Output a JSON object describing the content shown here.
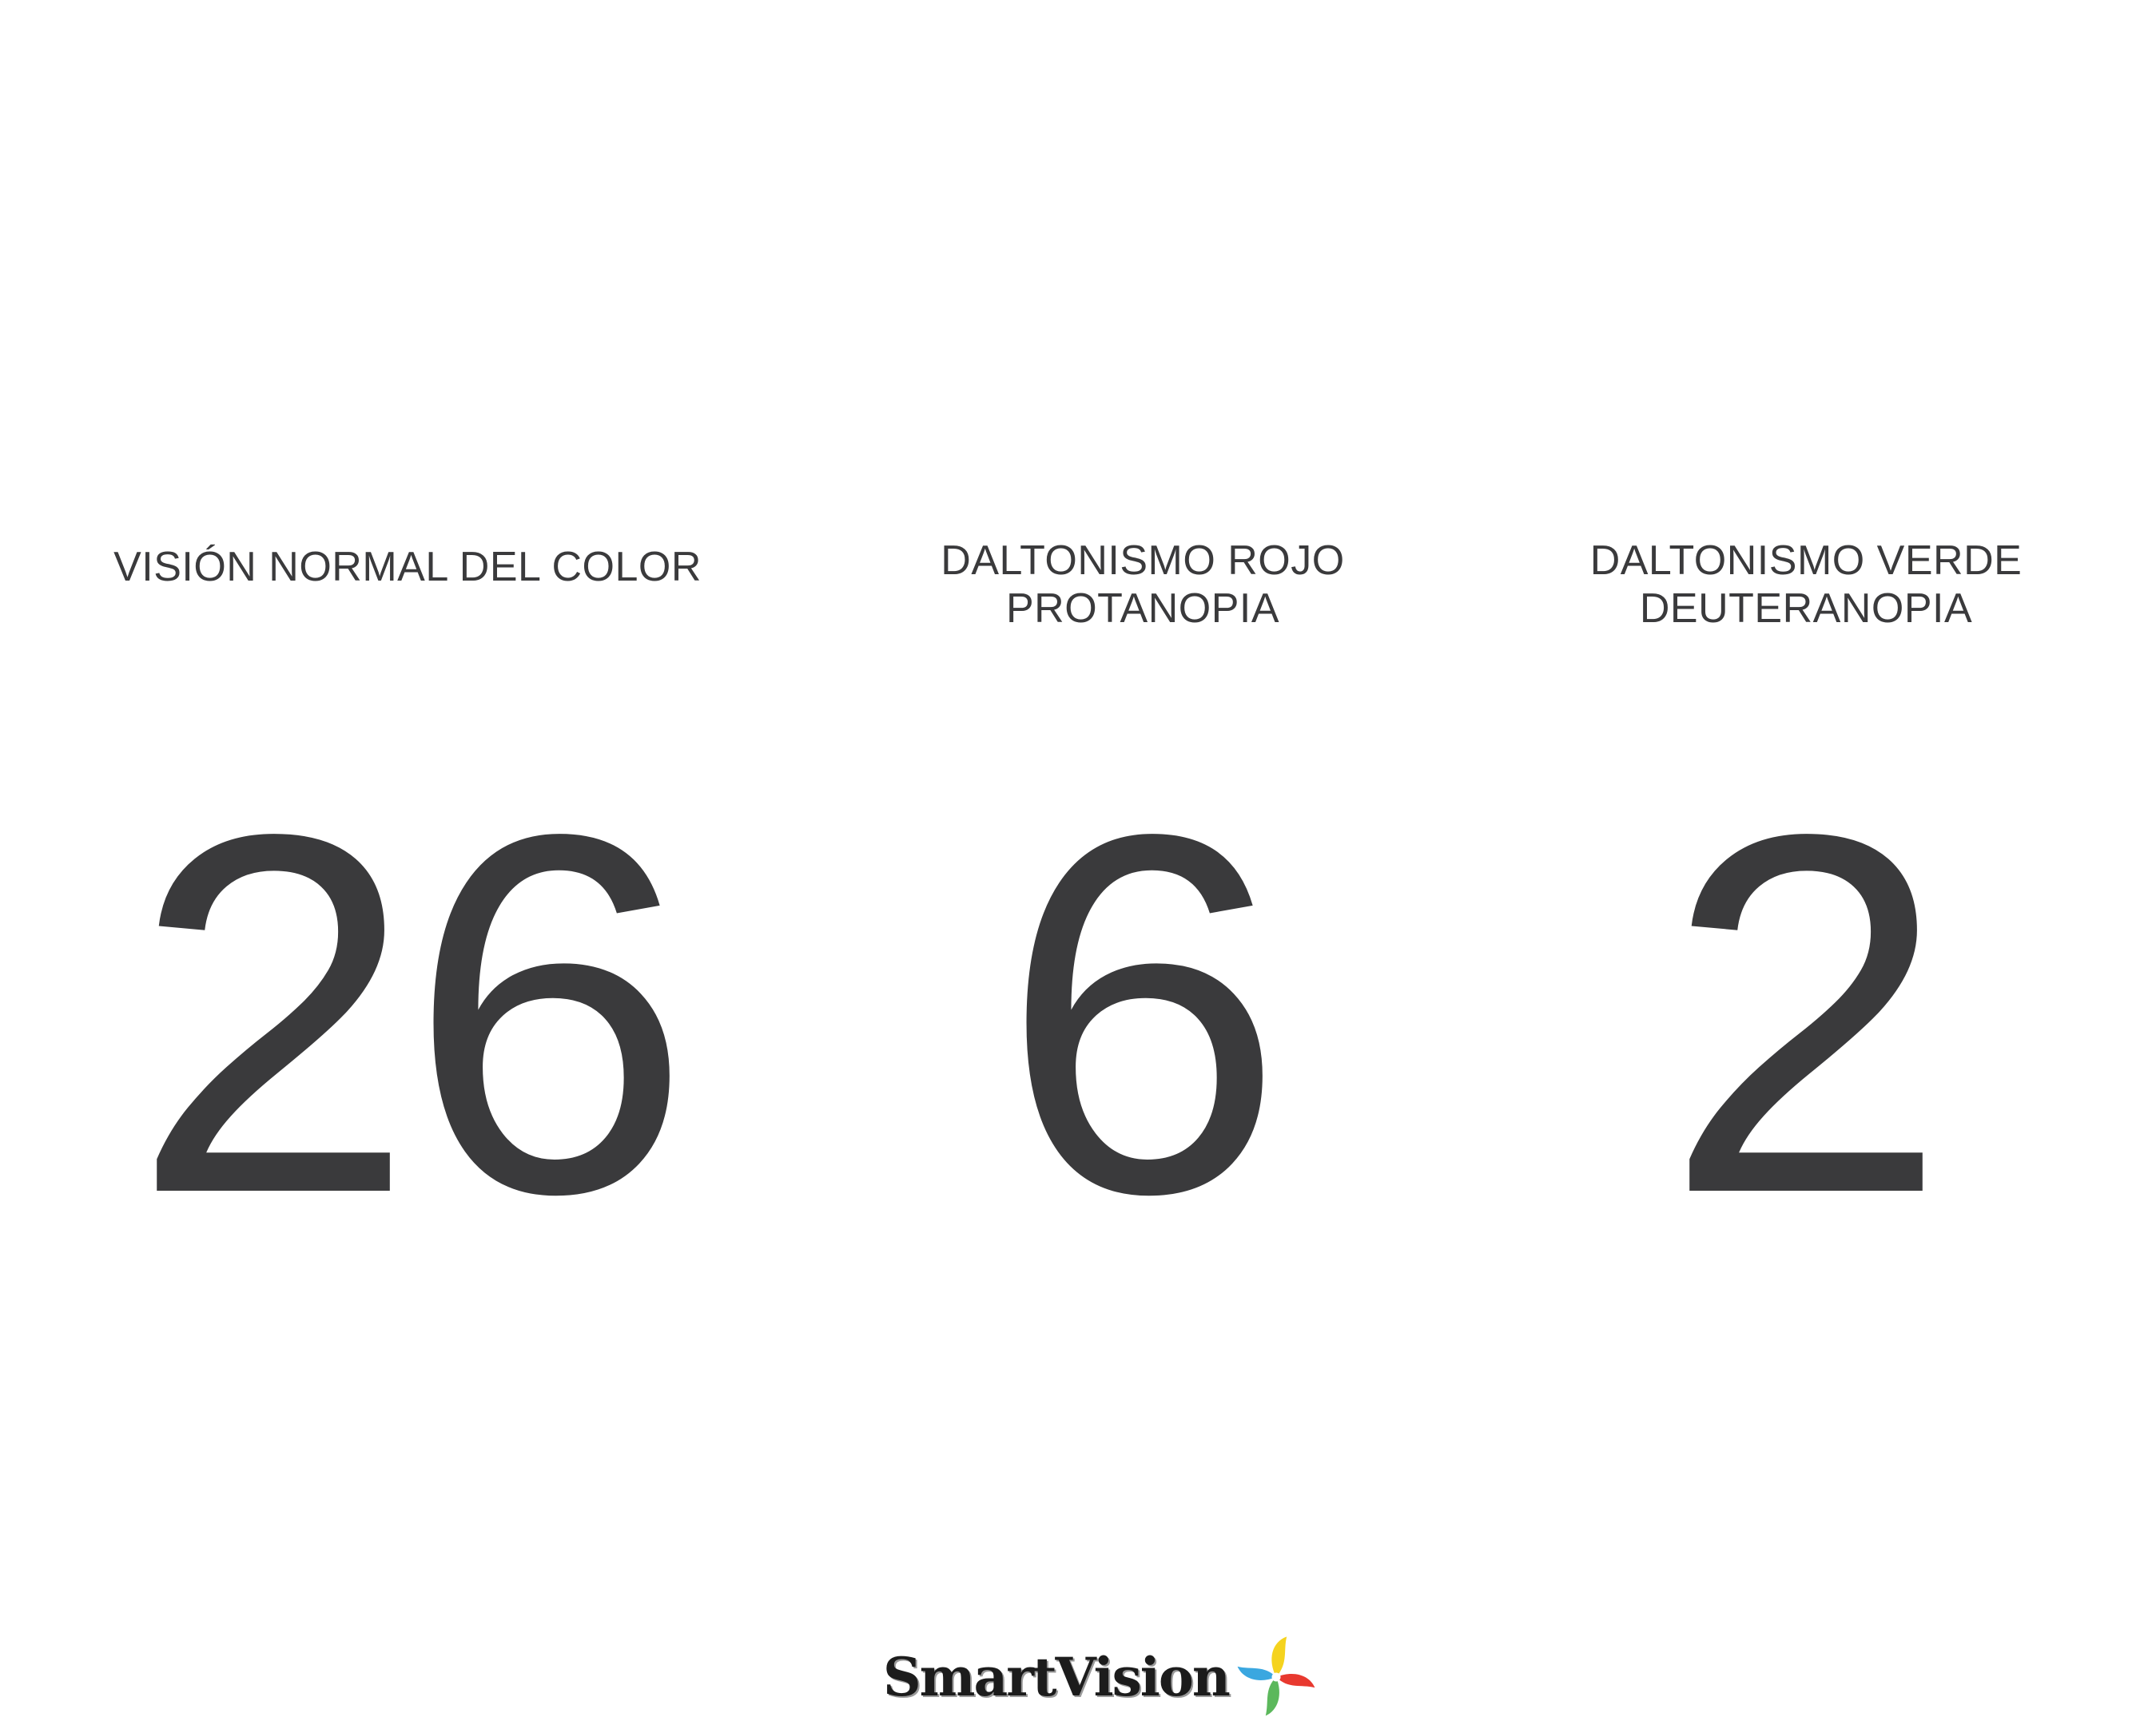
{
  "columns": [
    {
      "label_lines": [
        "VISIÓN NORMAL DEL COLOR"
      ],
      "number": "26"
    },
    {
      "label_lines": [
        "DALTONISMO ROJO",
        "PROTANOPIA"
      ],
      "number": "6"
    },
    {
      "label_lines": [
        "DALTONISMO VERDE",
        "DEUTERANOPIA"
      ],
      "number": "2"
    }
  ],
  "logo": {
    "text": "SmartVision",
    "icon": "pinwheel-logo-icon",
    "colors": [
      "#f5d31e",
      "#3aa7e0",
      "#e8392f",
      "#5cb85c"
    ]
  },
  "colors": {
    "text": "#3a3a3c",
    "background": "#ffffff"
  }
}
